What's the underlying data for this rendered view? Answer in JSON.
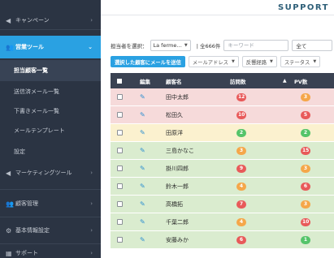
{
  "header": {
    "support_label": "SUPPORT"
  },
  "sidebar": {
    "campaign": "キャンペーン",
    "sales_tools": "営業ツール",
    "sub_items": [
      "担当顧客一覧",
      "送信済メール一覧",
      "下書きメール一覧",
      "メールテンプレート",
      "設定"
    ],
    "marketing": "マーケティングツール",
    "customers": "顧客管理",
    "basic_settings": "基本情報設定",
    "support": "サポート"
  },
  "filters": {
    "assignee_label": "担当者を選択：",
    "assignee_value": "La ferme…",
    "count_text": "全666件",
    "keyword_placeholder": "キーワード",
    "all_value": "全て"
  },
  "actions": {
    "mail_button": "選択した顧客にメールを送信",
    "email_dropdown": "メールアドレス",
    "response_dropdown": "反響経路",
    "status_dropdown": "ステータス"
  },
  "table": {
    "headers": {
      "edit": "編集",
      "name": "顧客名",
      "visits": "訪問数",
      "pv": "PV数"
    },
    "rows": [
      {
        "name": "田中太郎",
        "visits": "12",
        "visit_color": "red",
        "pv": "3",
        "pv_color": "orange",
        "row": "pink"
      },
      {
        "name": "松田久",
        "visits": "10",
        "visit_color": "red",
        "pv": "5",
        "pv_color": "red",
        "row": "pink"
      },
      {
        "name": "田原洋",
        "visits": "2",
        "visit_color": "green",
        "pv": "2",
        "pv_color": "green",
        "row": "yellow"
      },
      {
        "name": "三島かなこ",
        "visits": "3",
        "visit_color": "orange",
        "pv": "15",
        "pv_color": "red",
        "row": "green"
      },
      {
        "name": "掛川四郎",
        "visits": "9",
        "visit_color": "red",
        "pv": "3",
        "pv_color": "orange",
        "row": "green"
      },
      {
        "name": "鈴木一郎",
        "visits": "4",
        "visit_color": "orange",
        "pv": "6",
        "pv_color": "red",
        "row": "green"
      },
      {
        "name": "高橋拓",
        "visits": "7",
        "visit_color": "red",
        "pv": "3",
        "pv_color": "orange",
        "row": "green"
      },
      {
        "name": "千葉二郎",
        "visits": "4",
        "visit_color": "orange",
        "pv": "10",
        "pv_color": "red",
        "row": "green"
      },
      {
        "name": "安藤みか",
        "visits": "6",
        "visit_color": "red",
        "pv": "1",
        "pv_color": "green",
        "row": "green"
      }
    ]
  },
  "colors": {
    "sidebar_bg": "#2b3443",
    "accent_blue": "#2aa1e2",
    "badge_red": "#e85a5a",
    "badge_green": "#55c46a",
    "badge_orange": "#f5a74a"
  }
}
